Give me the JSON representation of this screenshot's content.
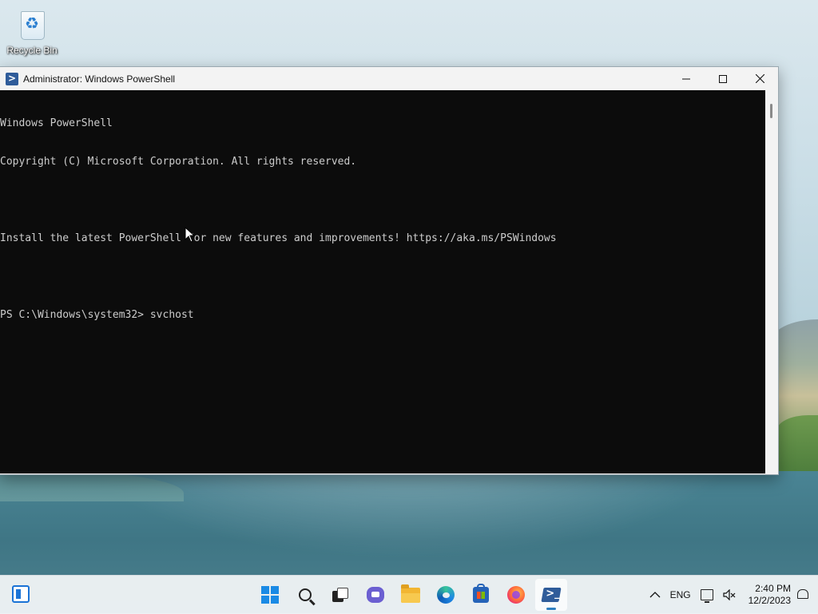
{
  "desktop": {
    "icons": [
      {
        "label": "Recycle Bin",
        "icon": "recycle-bin-icon"
      }
    ]
  },
  "window": {
    "title": "Administrator: Windows PowerShell",
    "app_icon": "powershell-icon",
    "controls": {
      "minimize": "—",
      "maximize": "☐",
      "close": "✕"
    }
  },
  "console": {
    "lines": [
      "Windows PowerShell",
      "Copyright (C) Microsoft Corporation. All rights reserved.",
      "",
      "Install the latest PowerShell for new features and improvements! https://aka.ms/PSWindows",
      "",
      "PS C:\\Windows\\system32> svchost"
    ]
  },
  "taskbar": {
    "apps": [
      {
        "name": "start",
        "icon": "windows-start-icon"
      },
      {
        "name": "search",
        "icon": "search-icon"
      },
      {
        "name": "task-view",
        "icon": "task-view-icon"
      },
      {
        "name": "chat",
        "icon": "chat-icon"
      },
      {
        "name": "file-explorer",
        "icon": "folder-icon"
      },
      {
        "name": "edge",
        "icon": "edge-icon"
      },
      {
        "name": "store",
        "icon": "store-icon"
      },
      {
        "name": "firefox",
        "icon": "firefox-icon"
      },
      {
        "name": "powershell",
        "icon": "powershell-icon",
        "active": true
      }
    ],
    "tray": {
      "chevron": "^",
      "language": "ENG",
      "time": "2:40 PM",
      "date": "12/2/2023"
    }
  }
}
